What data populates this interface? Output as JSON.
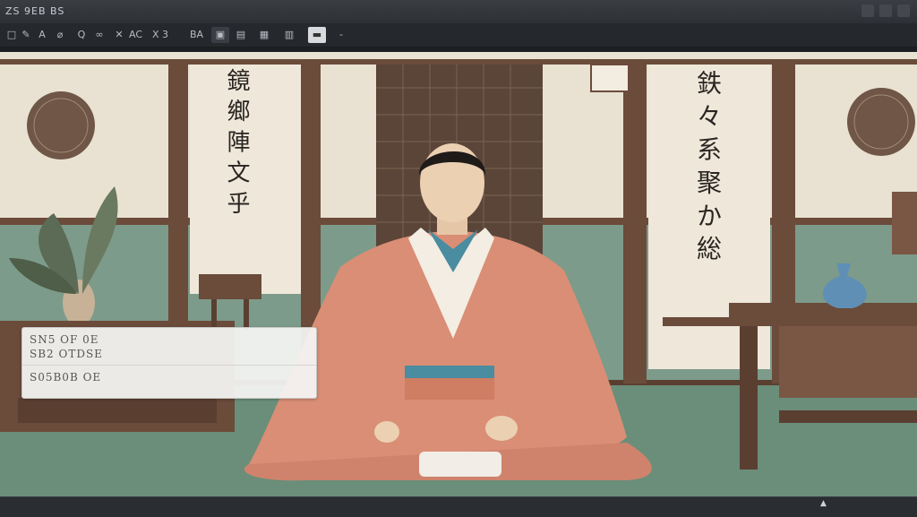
{
  "window": {
    "title": "ZS 9EB BS"
  },
  "toolbar": {
    "items": [
      {
        "label": "□"
      },
      {
        "label": "✎"
      },
      {
        "label": "A"
      },
      {
        "label": "⌀"
      },
      {
        "label": "Q"
      },
      {
        "label": "∞"
      },
      {
        "label": "✕"
      },
      {
        "label": "AC"
      },
      {
        "label": "X 3"
      },
      {
        "label": "BA"
      },
      {
        "label": "▣"
      },
      {
        "label": "▤"
      },
      {
        "label": "▦"
      },
      {
        "label": "▥"
      },
      {
        "label": "▬"
      },
      {
        "label": "-"
      }
    ]
  },
  "canvas": {
    "scroll_left": [
      "鏡",
      "鄉",
      "陣",
      "文",
      "乎"
    ],
    "scroll_right": [
      "鉄",
      "々",
      "系",
      "聚",
      "か",
      "総"
    ]
  },
  "overlay": {
    "line1": "SN5 OF 0E",
    "line2": "SB2 OTDSE",
    "line3": "S05B0B OE"
  },
  "colors": {
    "robe": "#d98e75",
    "collar": "#4a8ca0",
    "floor": "#6a8e7a",
    "wood": "#6b4b3a",
    "wall": "#e9e2d2"
  }
}
